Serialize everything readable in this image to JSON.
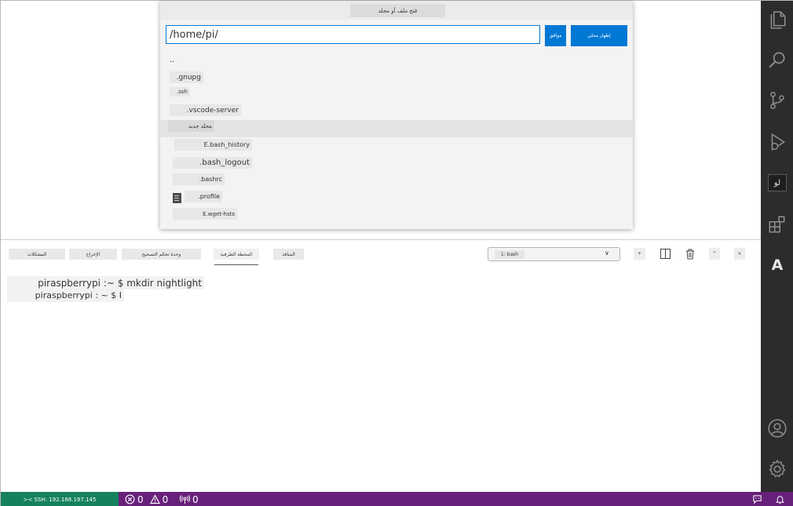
{
  "quick_open": {
    "title": "فتح ملف أو مجلد",
    "path_value": "/home/pi/",
    "ok_button": "موافق",
    "show_local_button": "إظهار محلي",
    "entries": [
      {
        "label": ".."
      },
      {
        "label": ".gnupg"
      },
      {
        "label": ".ssh"
      },
      {
        "label": ".vscode-server"
      },
      {
        "label": "مجلد جديد"
      },
      {
        "label": "E.bash_history"
      },
      {
        "label": ".bash_logout"
      },
      {
        "label": ".bashrc"
      },
      {
        "label": ".profile"
      },
      {
        "label": "E.wget-hsts"
      }
    ]
  },
  "panel": {
    "tabs": [
      {
        "label": "المشكلات"
      },
      {
        "label": "الإخراج"
      },
      {
        "label": "وحدة تحكم التصحيح"
      },
      {
        "label": "المحطة الطرفية"
      },
      {
        "label": "المنافذ"
      }
    ],
    "terminal_select": "1: bash",
    "terminal_lines": [
      "piraspberrypi :~ $ mkdir nightlight",
      "piraspberrypi : ~ $ I"
    ],
    "actions": {
      "add": "+",
      "maximize": "^",
      "close": "×"
    }
  },
  "activity_bar": {
    "remote_badge": "لو",
    "font_button": "A"
  },
  "status_bar": {
    "remote": "><  SSH: 192.168.197.145",
    "errors": "0",
    "warnings": "0",
    "ports": "0"
  }
}
